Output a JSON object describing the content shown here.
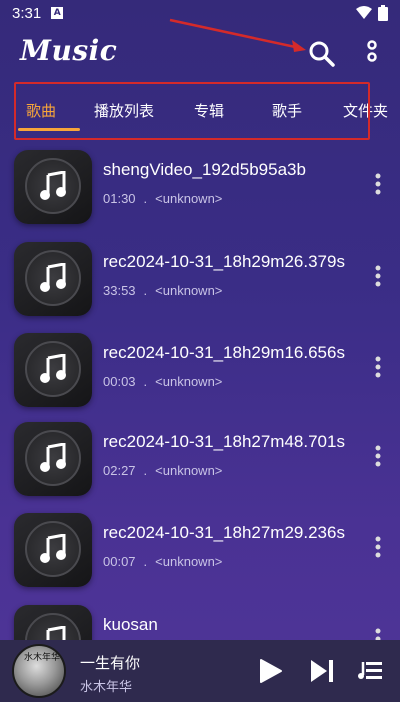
{
  "status_bar": {
    "time": "3:31",
    "notification_icon": "A"
  },
  "app_bar": {
    "logo": "Music",
    "icons": [
      "search-icon",
      "more-vert-icon"
    ]
  },
  "tabs": [
    {
      "label": "歌曲",
      "active": true
    },
    {
      "label": "播放列表",
      "active": false
    },
    {
      "label": "专辑",
      "active": false
    },
    {
      "label": "歌手",
      "active": false
    },
    {
      "label": "文件夹",
      "active": false
    }
  ],
  "songs": [
    {
      "title": "shengVideo_192d5b95a3b",
      "duration": "01:30",
      "dot": ".",
      "artist": "<unknown>"
    },
    {
      "title": "rec2024-10-31_18h29m26.379s",
      "duration": "33:53",
      "dot": ".",
      "artist": "<unknown>"
    },
    {
      "title": "rec2024-10-31_18h29m16.656s",
      "duration": "00:03",
      "dot": ".",
      "artist": "<unknown>"
    },
    {
      "title": "rec2024-10-31_18h27m48.701s",
      "duration": "02:27",
      "dot": ".",
      "artist": "<unknown>"
    },
    {
      "title": "rec2024-10-31_18h27m29.236s",
      "duration": "00:07",
      "dot": ".",
      "artist": "<unknown>"
    },
    {
      "title": "kuosan",
      "duration": "",
      "dot": "",
      "artist": ""
    }
  ],
  "now_playing": {
    "title": "一生有你",
    "artist": "水木年华",
    "art_text": "水木年华"
  },
  "colors": {
    "accent": "#f7a53a",
    "annotation": "#d42a2a",
    "background": "#3a2d86"
  }
}
